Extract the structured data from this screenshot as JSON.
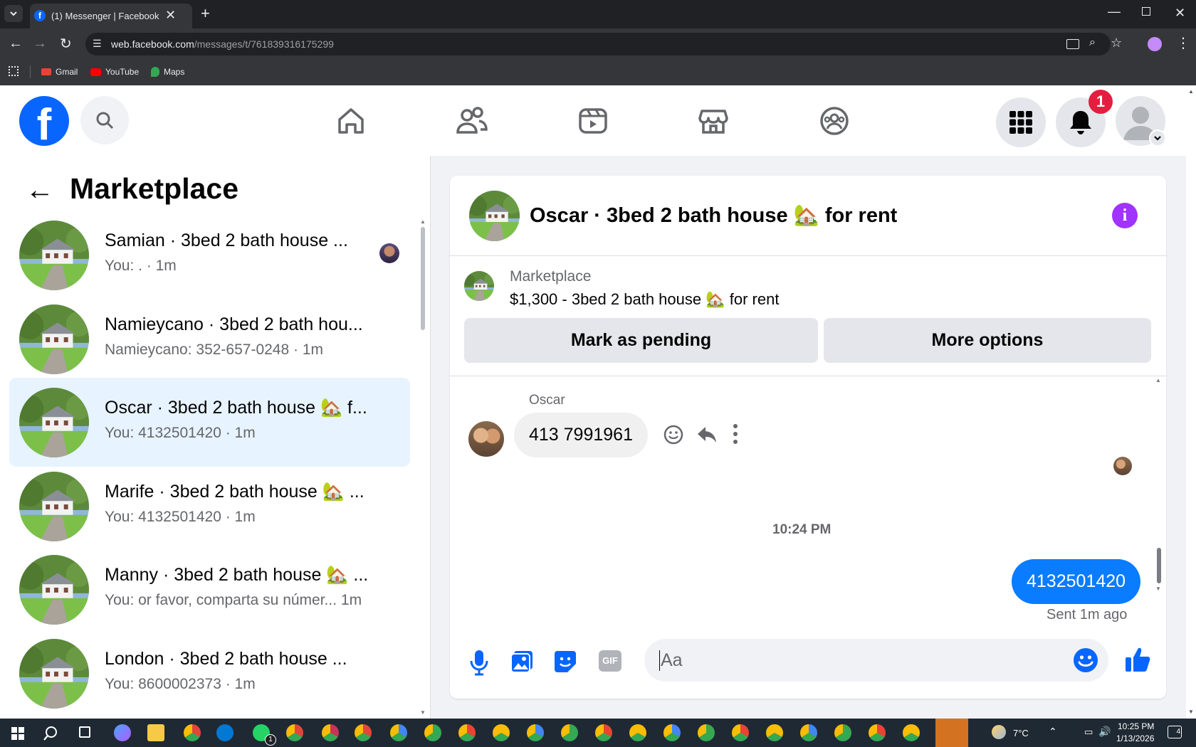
{
  "browser": {
    "tab_title": "(1) Messenger | Facebook",
    "url_domain": "web.facebook.com",
    "url_path": "/messages/t/761839316175299",
    "bookmarks": [
      {
        "label": "Gmail",
        "icon": "gmail-icon"
      },
      {
        "label": "YouTube",
        "icon": "youtube-icon"
      },
      {
        "label": "Maps",
        "icon": "maps-icon"
      }
    ]
  },
  "header": {
    "notification_count": "1"
  },
  "left_panel": {
    "title": "Marketplace",
    "conversations": [
      {
        "title": "Samian · 3bed 2 bath house ...",
        "subtitle": "You: . · 1m",
        "active": false
      },
      {
        "title": "Namieycano · 3bed 2 bath hou...",
        "subtitle": "Namieycano: 352-657-0248 · 1m",
        "active": false
      },
      {
        "title": "Oscar · 3bed 2 bath house 🏡 f...",
        "subtitle": "You: 4132501420 · 1m",
        "active": true
      },
      {
        "title": "Marife · 3bed 2 bath house 🏡 ...",
        "subtitle": "You: 4132501420 · 1m",
        "active": false
      },
      {
        "title": "Manny · 3bed 2 bath house 🏡 ...",
        "subtitle": "You: or favor, comparta su númer...  1m",
        "active": false
      },
      {
        "title": "London · 3bed 2 bath house ...",
        "subtitle": "You: 8600002373 · 1m",
        "active": false
      }
    ]
  },
  "chat": {
    "header_title": "Oscar · 3bed 2 bath house 🏡 for rent",
    "listing_source": "Marketplace",
    "listing_title": "$1,300 - 3bed 2 bath house 🏡 for rent",
    "mark_pending_label": "Mark as pending",
    "more_options_label": "More options",
    "incoming_sender": "Oscar",
    "incoming_message": "413 7991961",
    "timestamp": "10:24 PM",
    "outgoing_message": "4132501420",
    "outgoing_status": "Sent 1m ago",
    "composer_placeholder": "Aa"
  },
  "taskbar": {
    "weather": "7°C",
    "time": "10:25 PM",
    "date": "1/13/2026",
    "notification_badge": "4",
    "whatsapp_badge": "1"
  },
  "colors": {
    "facebook_blue": "#0866ff",
    "messenger_bubble": "#0a7cff",
    "info_purple": "#a033ff",
    "active_row": "#e7f3ff"
  }
}
